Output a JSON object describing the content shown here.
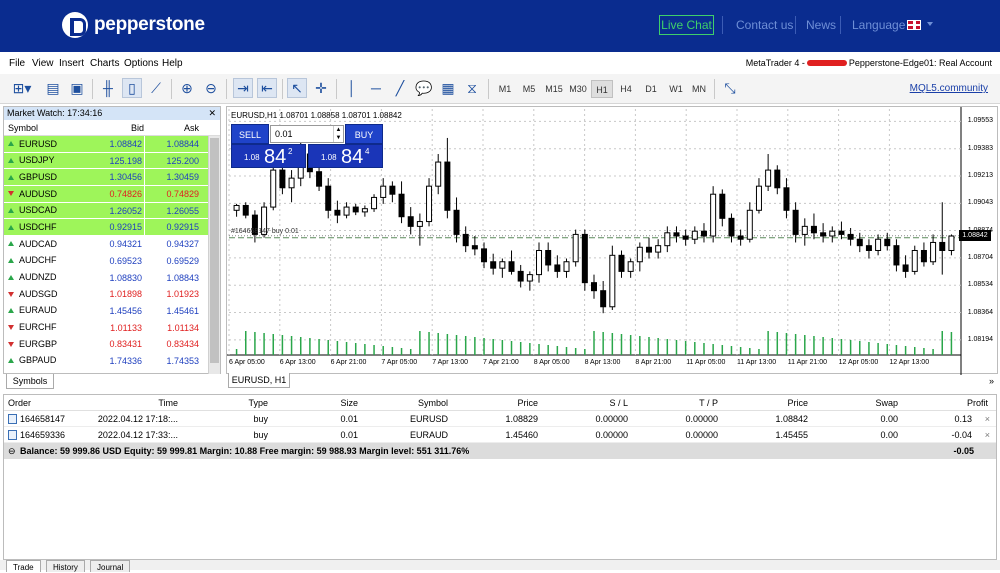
{
  "header": {
    "brand": "pepperstone",
    "live_chat": "Live Chat",
    "contact_us": "Contact us",
    "news": "News",
    "language": "Language",
    "colors": {
      "header_bg": "#0a2c8f",
      "live_chat": "#3fcf6a",
      "nav_link": "#6f8fd6"
    }
  },
  "menubar": {
    "items": [
      "File",
      "View",
      "Insert",
      "Charts",
      "Options",
      "Help"
    ],
    "account_prefix": "MetaTrader 4 -",
    "account_suffix": "Pepperstone-Edge01: Real Account"
  },
  "toolbar": {
    "timeframes": [
      "M1",
      "M5",
      "M15",
      "M30",
      "H1",
      "H4",
      "D1",
      "W1",
      "MN"
    ],
    "active_timeframe": "H1",
    "mql5": "MQL5.community"
  },
  "market_watch": {
    "title": "Market Watch: 17:34:16",
    "headers": {
      "symbol": "Symbol",
      "bid": "Bid",
      "ask": "Ask"
    },
    "rows": [
      {
        "symbol": "EURUSD",
        "bid": "1.08842",
        "ask": "1.08844",
        "dir": "up",
        "highlight": true
      },
      {
        "symbol": "USDJPY",
        "bid": "125.198",
        "ask": "125.200",
        "dir": "up",
        "highlight": true
      },
      {
        "symbol": "GBPUSD",
        "bid": "1.30456",
        "ask": "1.30459",
        "dir": "up",
        "highlight": true
      },
      {
        "symbol": "AUDUSD",
        "bid": "0.74826",
        "ask": "0.74829",
        "dir": "down",
        "highlight": true
      },
      {
        "symbol": "USDCAD",
        "bid": "1.26052",
        "ask": "1.26055",
        "dir": "up",
        "highlight": true
      },
      {
        "symbol": "USDCHF",
        "bid": "0.92915",
        "ask": "0.92915",
        "dir": "up",
        "highlight": true
      },
      {
        "symbol": "AUDCAD",
        "bid": "0.94321",
        "ask": "0.94327",
        "dir": "up",
        "highlight": false
      },
      {
        "symbol": "AUDCHF",
        "bid": "0.69523",
        "ask": "0.69529",
        "dir": "up",
        "highlight": false
      },
      {
        "symbol": "AUDNZD",
        "bid": "1.08830",
        "ask": "1.08843",
        "dir": "up",
        "highlight": false
      },
      {
        "symbol": "AUDSGD",
        "bid": "1.01898",
        "ask": "1.01923",
        "dir": "down",
        "highlight": false
      },
      {
        "symbol": "EURAUD",
        "bid": "1.45456",
        "ask": "1.45461",
        "dir": "up",
        "highlight": false
      },
      {
        "symbol": "EURCHF",
        "bid": "1.01133",
        "ask": "1.01134",
        "dir": "down",
        "highlight": false
      },
      {
        "symbol": "EURGBP",
        "bid": "0.83431",
        "ask": "0.83434",
        "dir": "down",
        "highlight": false
      },
      {
        "symbol": "GBPAUD",
        "bid": "1.74336",
        "ask": "1.74353",
        "dir": "up",
        "highlight": false
      }
    ],
    "tab": "Symbols"
  },
  "chart": {
    "ohlc": "EURUSD,H1  1.08701 1.08858 1.08701 1.08842",
    "sell": "SELL",
    "buy": "BUY",
    "lot": "0.01",
    "sell_small": "1.08",
    "sell_big": "84",
    "sell_sup": "2",
    "buy_small": "1.08",
    "buy_big": "84",
    "buy_sup": "4",
    "order_line": "#164658147 buy 0.01",
    "current_price": "1.08842",
    "tab": "EURUSD, H1"
  },
  "chart_data": {
    "type": "candlestick",
    "symbol": "EURUSD",
    "timeframe": "H1",
    "y_ticks": [
      "1.09553",
      "1.09383",
      "1.09213",
      "1.09043",
      "1.08874",
      "1.08704",
      "1.08534",
      "1.08364",
      "1.08194"
    ],
    "x_ticks": [
      "6 Apr 05:00",
      "6 Apr 13:00",
      "6 Apr 21:00",
      "7 Apr 05:00",
      "7 Apr 13:00",
      "7 Apr 21:00",
      "8 Apr 05:00",
      "8 Apr 13:00",
      "8 Apr 21:00",
      "11 Apr 05:00",
      "11 Apr 13:00",
      "11 Apr 21:00",
      "12 Apr 05:00",
      "12 Apr 13:00"
    ],
    "ylim": [
      1.081,
      1.0963
    ],
    "current_price": 1.08842,
    "order_price": 1.08829,
    "candles": [
      [
        1.09,
        1.0904,
        1.0896,
        1.0903
      ],
      [
        1.0903,
        1.0905,
        1.0895,
        1.0897
      ],
      [
        1.0897,
        1.09,
        1.088,
        1.0885
      ],
      [
        1.0885,
        1.0905,
        1.0883,
        1.0902
      ],
      [
        1.0902,
        1.093,
        1.09,
        1.0925
      ],
      [
        1.0925,
        1.0928,
        1.091,
        1.0914
      ],
      [
        1.0914,
        1.0925,
        1.0905,
        1.092
      ],
      [
        1.092,
        1.0945,
        1.0915,
        1.0935
      ],
      [
        1.0935,
        1.0938,
        1.092,
        1.0924
      ],
      [
        1.0924,
        1.093,
        1.0912,
        1.0915
      ],
      [
        1.0915,
        1.092,
        1.0895,
        1.09
      ],
      [
        1.09,
        1.0906,
        1.0892,
        1.0897
      ],
      [
        1.0897,
        1.0905,
        1.0895,
        1.0902
      ],
      [
        1.0902,
        1.0904,
        1.0897,
        1.0899
      ],
      [
        1.0899,
        1.0903,
        1.0896,
        1.0901
      ],
      [
        1.0901,
        1.091,
        1.0899,
        1.0908
      ],
      [
        1.0908,
        1.092,
        1.0904,
        1.0915
      ],
      [
        1.0915,
        1.0918,
        1.0905,
        1.091
      ],
      [
        1.091,
        1.0918,
        1.0892,
        1.0896
      ],
      [
        1.0896,
        1.0902,
        1.0885,
        1.089
      ],
      [
        1.089,
        1.0898,
        1.0878,
        1.0893
      ],
      [
        1.0893,
        1.092,
        1.089,
        1.0915
      ],
      [
        1.0915,
        1.0935,
        1.091,
        1.093
      ],
      [
        1.093,
        1.0945,
        1.0895,
        1.09
      ],
      [
        1.09,
        1.0908,
        1.088,
        1.0885
      ],
      [
        1.0885,
        1.089,
        1.0874,
        1.0878
      ],
      [
        1.0878,
        1.0884,
        1.0872,
        1.0876
      ],
      [
        1.0876,
        1.088,
        1.0864,
        1.0868
      ],
      [
        1.0868,
        1.0873,
        1.086,
        1.0864
      ],
      [
        1.0864,
        1.087,
        1.0858,
        1.0868
      ],
      [
        1.0868,
        1.0875,
        1.086,
        1.0862
      ],
      [
        1.0862,
        1.0866,
        1.0852,
        1.0856
      ],
      [
        1.0856,
        1.0862,
        1.085,
        1.086
      ],
      [
        1.086,
        1.088,
        1.0855,
        1.0875
      ],
      [
        1.0875,
        1.088,
        1.0862,
        1.0866
      ],
      [
        1.0866,
        1.0872,
        1.0858,
        1.0862
      ],
      [
        1.0862,
        1.087,
        1.0858,
        1.0868
      ],
      [
        1.0868,
        1.0888,
        1.0865,
        1.0885
      ],
      [
        1.0885,
        1.0888,
        1.085,
        1.0855
      ],
      [
        1.0855,
        1.086,
        1.0845,
        1.085
      ],
      [
        1.085,
        1.0856,
        1.0836,
        1.084
      ],
      [
        1.084,
        1.0878,
        1.0838,
        1.0872
      ],
      [
        1.0872,
        1.0875,
        1.0858,
        1.0862
      ],
      [
        1.0862,
        1.087,
        1.0858,
        1.0868
      ],
      [
        1.0868,
        1.088,
        1.0862,
        1.0877
      ],
      [
        1.0877,
        1.0883,
        1.087,
        1.0874
      ],
      [
        1.0874,
        1.0882,
        1.087,
        1.0878
      ],
      [
        1.0878,
        1.089,
        1.0874,
        1.0886
      ],
      [
        1.0886,
        1.089,
        1.088,
        1.0884
      ],
      [
        1.0884,
        1.0888,
        1.0878,
        1.0882
      ],
      [
        1.0882,
        1.089,
        1.0879,
        1.0887
      ],
      [
        1.0887,
        1.0892,
        1.088,
        1.0884
      ],
      [
        1.0884,
        1.0915,
        1.088,
        1.091
      ],
      [
        1.091,
        1.0913,
        1.089,
        1.0895
      ],
      [
        1.0895,
        1.0898,
        1.088,
        1.0884
      ],
      [
        1.0884,
        1.0888,
        1.0878,
        1.0882
      ],
      [
        1.0882,
        1.0905,
        1.088,
        1.09
      ],
      [
        1.09,
        1.092,
        1.0898,
        1.0915
      ],
      [
        1.0915,
        1.0935,
        1.0912,
        1.0925
      ],
      [
        1.0925,
        1.0928,
        1.091,
        1.0914
      ],
      [
        1.0914,
        1.092,
        1.0895,
        1.09
      ],
      [
        1.09,
        1.0905,
        1.088,
        1.0885
      ],
      [
        1.0885,
        1.0895,
        1.0878,
        1.089
      ],
      [
        1.089,
        1.0898,
        1.0882,
        1.0886
      ],
      [
        1.0886,
        1.0892,
        1.088,
        1.0884
      ],
      [
        1.0884,
        1.089,
        1.088,
        1.0887
      ],
      [
        1.0887,
        1.0893,
        1.0882,
        1.0885
      ],
      [
        1.0885,
        1.0889,
        1.0878,
        1.0882
      ],
      [
        1.0882,
        1.0886,
        1.0874,
        1.0878
      ],
      [
        1.0878,
        1.0882,
        1.087,
        1.0875
      ],
      [
        1.0875,
        1.0885,
        1.0872,
        1.0882
      ],
      [
        1.0882,
        1.0886,
        1.0875,
        1.0878
      ],
      [
        1.0878,
        1.0882,
        1.0862,
        1.0866
      ],
      [
        1.0866,
        1.0872,
        1.0858,
        1.0862
      ],
      [
        1.0862,
        1.0878,
        1.086,
        1.0875
      ],
      [
        1.0875,
        1.088,
        1.0865,
        1.0868
      ],
      [
        1.0868,
        1.0885,
        1.0866,
        1.088
      ],
      [
        1.088,
        1.0905,
        1.086,
        1.0875
      ],
      [
        1.0875,
        1.0885,
        1.0872,
        1.0884
      ]
    ]
  },
  "terminal": {
    "headers": [
      "Order",
      "Time",
      "Type",
      "Size",
      "Symbol",
      "Price",
      "S / L",
      "T / P",
      "Price",
      "Swap",
      "Profit"
    ],
    "rows": [
      [
        "164658147",
        "2022.04.12 17:18:...",
        "buy",
        "0.01",
        "EURUSD",
        "1.08829",
        "0.00000",
        "0.00000",
        "1.08842",
        "0.00",
        "0.13"
      ],
      [
        "164659336",
        "2022.04.12 17:33:...",
        "buy",
        "0.01",
        "EURAUD",
        "1.45460",
        "0.00000",
        "0.00000",
        "1.45455",
        "0.00",
        "-0.04"
      ]
    ],
    "balance_line": "Balance: 59 999.86 USD  Equity: 59 999.81  Margin: 10.88  Free margin: 59 988.93  Margin level: 551 311.76%",
    "balance_profit": "-0.05",
    "tabs": [
      "Trade",
      "History",
      "Journal"
    ]
  }
}
